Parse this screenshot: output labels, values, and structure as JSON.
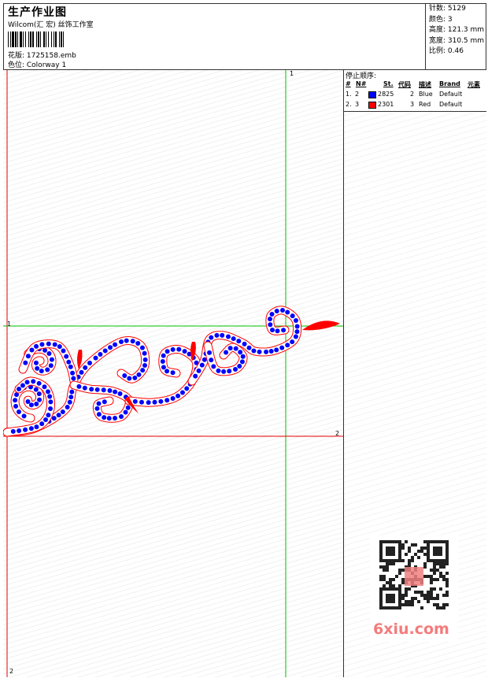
{
  "header": {
    "title": "生产作业图",
    "company": "Wilcom(汇 宏) 丝饰工作室",
    "design_label": "花版: 1725158.emb",
    "colorway_label": "色位: Colorway 1"
  },
  "stats": {
    "stitches": "针数: 5129",
    "colors": "颜色: 3",
    "height": "高度: 121.3 mm",
    "width": "宽度: 310.5 mm",
    "scale": "比例: 0.46"
  },
  "stop_sequence": {
    "title": "停止顺序:",
    "headers": {
      "index": "#",
      "no": "N#",
      "st": "St.",
      "code": "代码",
      "desc": "描述",
      "brand": "Brand",
      "element": "元素"
    },
    "rows": [
      {
        "index": "1.",
        "no": "2",
        "st": "2825",
        "code": "2",
        "desc": "Blue",
        "brand": "Default",
        "color": "#0000ff"
      },
      {
        "index": "2.",
        "no": "3",
        "st": "2301",
        "code": "3",
        "desc": "Red",
        "brand": "Default",
        "color": "#ff0000"
      }
    ]
  },
  "axis_markers": {
    "top": "1",
    "left": "1",
    "right": "2",
    "bottom": "2"
  },
  "colors": {
    "guide_green": "#00c000",
    "guide_red": "#e00000",
    "bead_blue": "#0000ff",
    "outline_red": "#ff0000",
    "watermark": "#f47b7b"
  },
  "watermark": {
    "text": "6xiu.com",
    "qr_badge": "汉图绣图"
  }
}
